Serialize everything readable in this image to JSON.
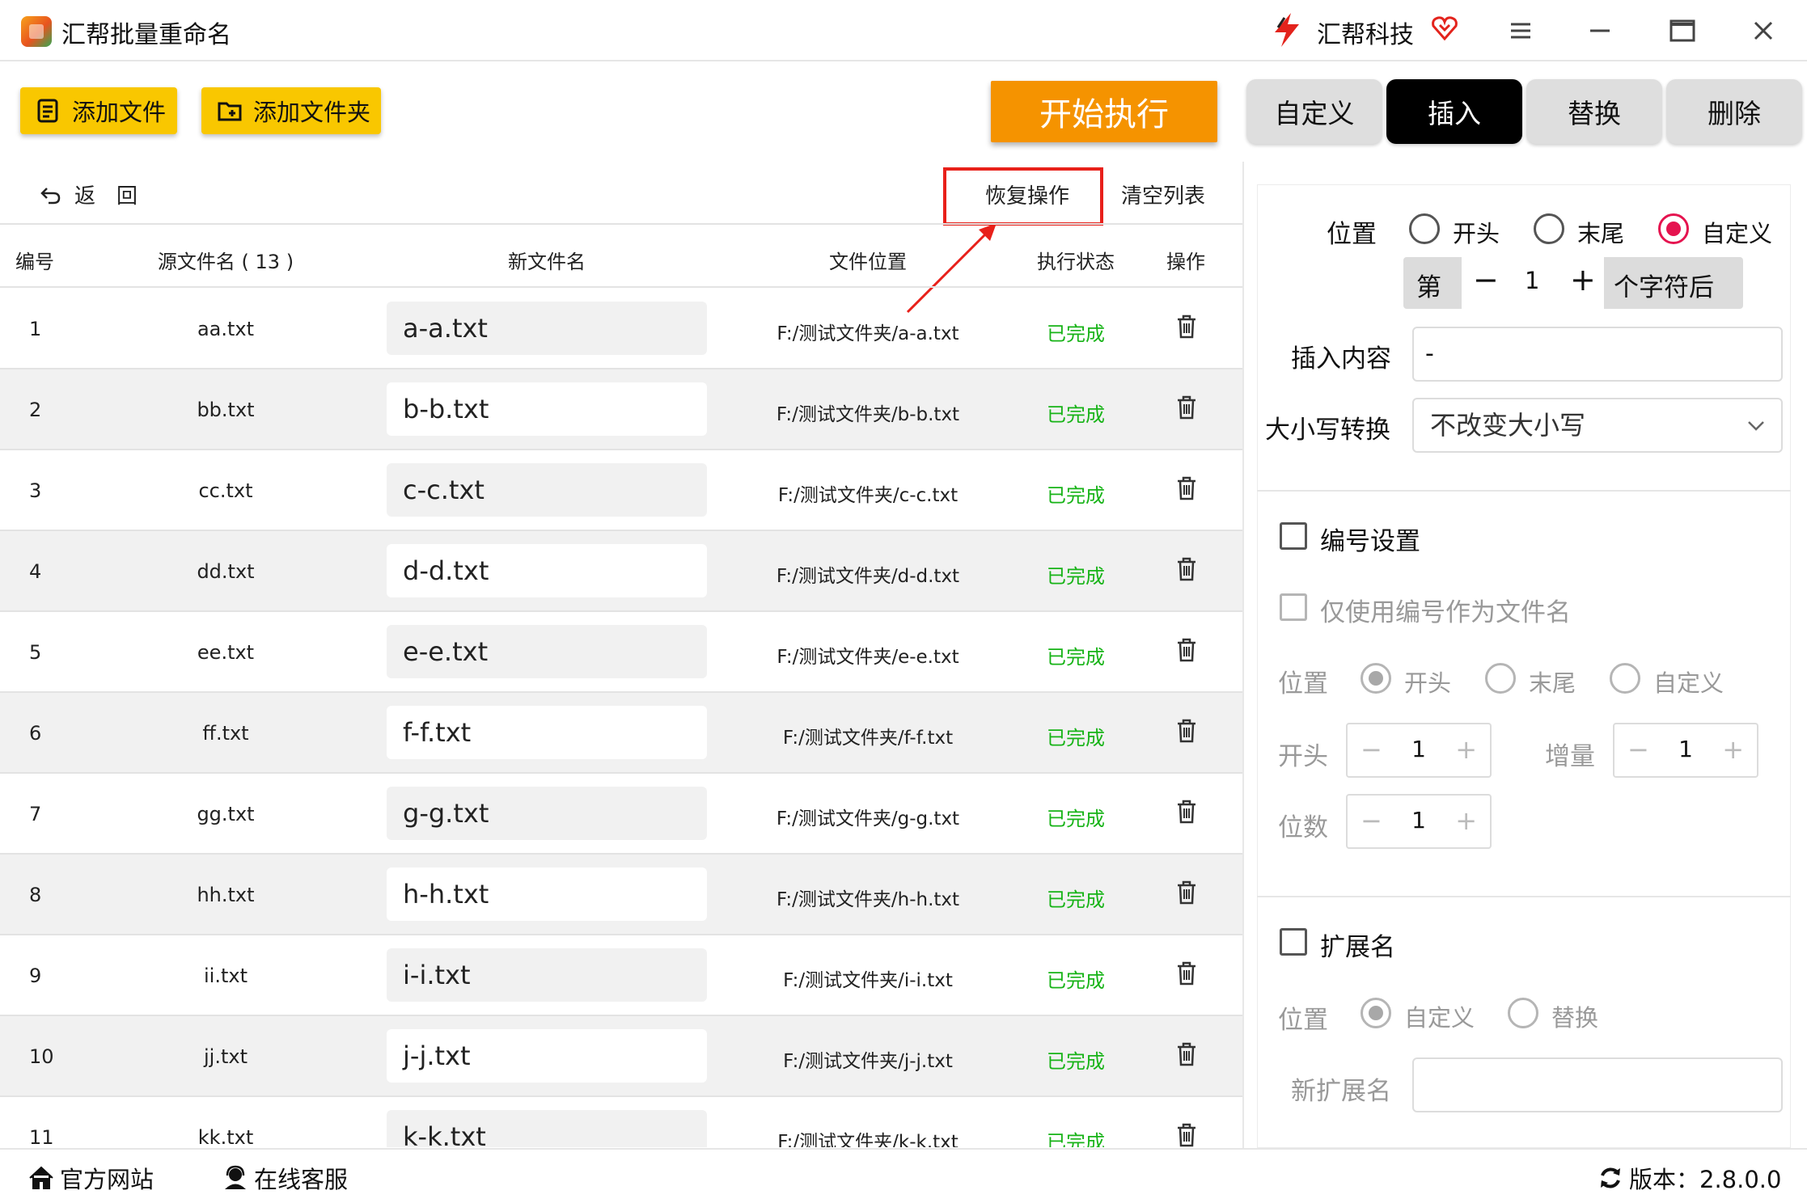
{
  "app": {
    "title": "汇帮批量重命名",
    "brand": "汇帮科技"
  },
  "toolbar": {
    "add_file": "添加文件",
    "add_folder": "添加文件夹",
    "start": "开始执行"
  },
  "tabs": [
    {
      "label": "自定义",
      "active": false
    },
    {
      "label": "插入",
      "active": true
    },
    {
      "label": "替换",
      "active": false
    },
    {
      "label": "删除",
      "active": false
    }
  ],
  "actions": {
    "back": "返回",
    "restore": "恢复操作",
    "clear": "清空列表"
  },
  "table": {
    "headers": {
      "num": "编号",
      "src": "源文件名 ( 13 )",
      "new": "新文件名",
      "path": "文件位置",
      "status": "执行状态",
      "op": "操作"
    },
    "rows": [
      {
        "num": "1",
        "src": "aa.txt",
        "new": "a-a.txt",
        "path": "F:/测试文件夹/a-a.txt",
        "status": "已完成"
      },
      {
        "num": "2",
        "src": "bb.txt",
        "new": "b-b.txt",
        "path": "F:/测试文件夹/b-b.txt",
        "status": "已完成"
      },
      {
        "num": "3",
        "src": "cc.txt",
        "new": "c-c.txt",
        "path": "F:/测试文件夹/c-c.txt",
        "status": "已完成"
      },
      {
        "num": "4",
        "src": "dd.txt",
        "new": "d-d.txt",
        "path": "F:/测试文件夹/d-d.txt",
        "status": "已完成"
      },
      {
        "num": "5",
        "src": "ee.txt",
        "new": "e-e.txt",
        "path": "F:/测试文件夹/e-e.txt",
        "status": "已完成"
      },
      {
        "num": "6",
        "src": "ff.txt",
        "new": "f-f.txt",
        "path": "F:/测试文件夹/f-f.txt",
        "status": "已完成"
      },
      {
        "num": "7",
        "src": "gg.txt",
        "new": "g-g.txt",
        "path": "F:/测试文件夹/g-g.txt",
        "status": "已完成"
      },
      {
        "num": "8",
        "src": "hh.txt",
        "new": "h-h.txt",
        "path": "F:/测试文件夹/h-h.txt",
        "status": "已完成"
      },
      {
        "num": "9",
        "src": "ii.txt",
        "new": "i-i.txt",
        "path": "F:/测试文件夹/i-i.txt",
        "status": "已完成"
      },
      {
        "num": "10",
        "src": "jj.txt",
        "new": "j-j.txt",
        "path": "F:/测试文件夹/j-j.txt",
        "status": "已完成"
      },
      {
        "num": "11",
        "src": "kk.txt",
        "new": "k-k.txt",
        "path": "F:/测试文件夹/k-k.txt",
        "status": "已完成"
      }
    ]
  },
  "insert_panel": {
    "position_label": "位置",
    "position_options": [
      "开头",
      "末尾",
      "自定义"
    ],
    "position_selected": "自定义",
    "char_prefix": "第",
    "char_value": "1",
    "char_suffix": "个字符后",
    "content_label": "插入内容",
    "content_value": "-",
    "case_label": "大小写转换",
    "case_value": "不改变大小写"
  },
  "numbering": {
    "title": "编号设置",
    "only_number": "仅使用编号作为文件名",
    "position_label": "位置",
    "position_options": [
      "开头",
      "末尾",
      "自定义"
    ],
    "position_selected": "开头",
    "start_label": "开头",
    "start_value": "1",
    "increment_label": "增量",
    "increment_value": "1",
    "digits_label": "位数",
    "digits_value": "1"
  },
  "extension": {
    "title": "扩展名",
    "position_label": "位置",
    "position_options": [
      "自定义",
      "替换"
    ],
    "position_selected": "自定义",
    "new_ext_label": "新扩展名",
    "new_ext_value": ""
  },
  "footer": {
    "website": "官方网站",
    "support": "在线客服",
    "version": "版本：2.8.0.0"
  },
  "colors": {
    "accent_yellow": "#f9c700",
    "start_orange": "#f59300",
    "status_green": "#17b317",
    "radio_red": "#e5134f",
    "highlight_red": "#e8201a"
  }
}
